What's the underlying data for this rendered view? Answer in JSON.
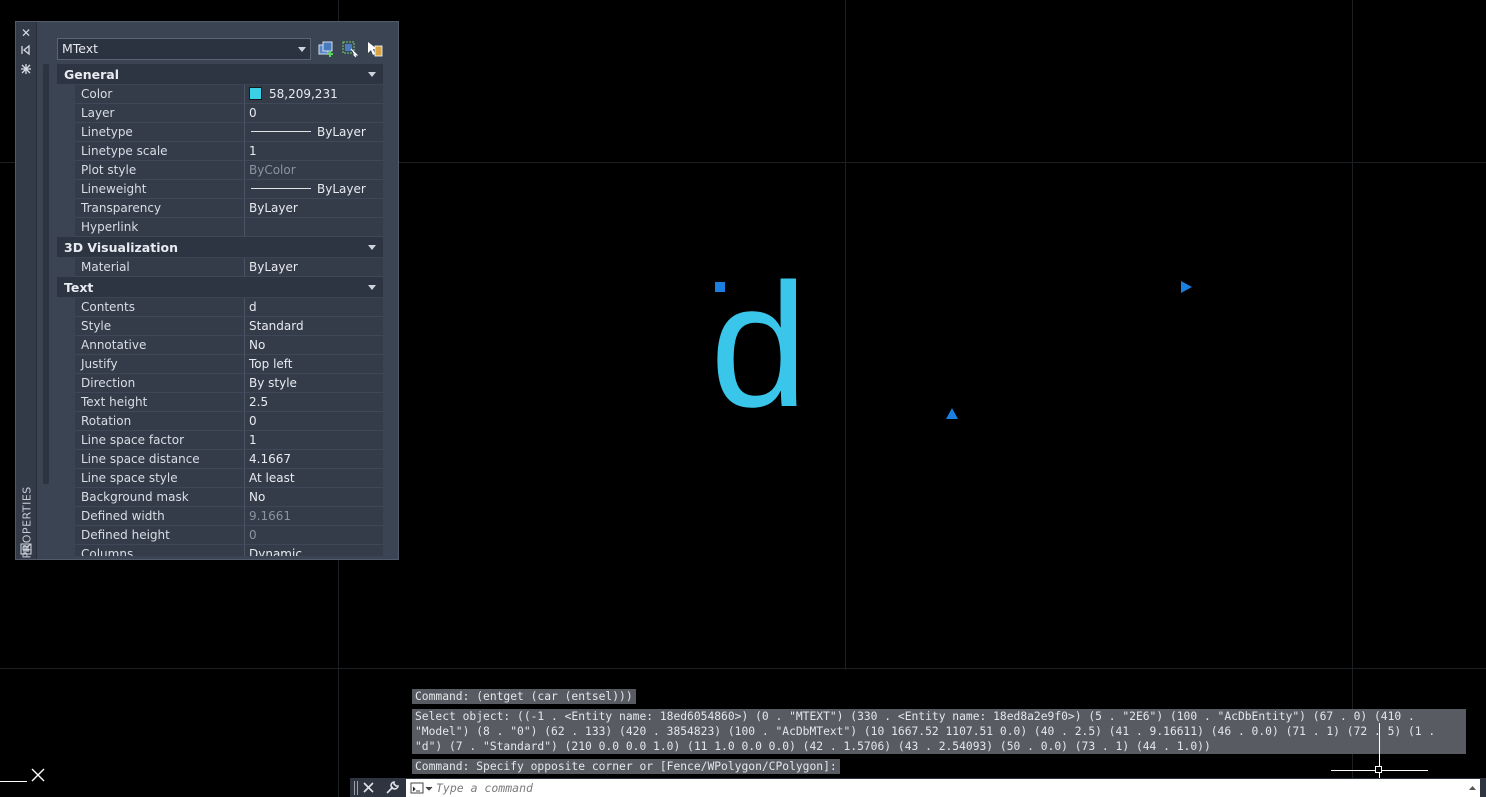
{
  "palette": {
    "title": "PROPERTIES",
    "object_type": "MText",
    "categories": [
      {
        "name": "General",
        "rows": [
          {
            "label": "Color",
            "value": "58,209,231",
            "swatch": "#3ad1e7"
          },
          {
            "label": "Layer",
            "value": "0"
          },
          {
            "label": "Linetype",
            "value": "ByLayer",
            "line": true
          },
          {
            "label": "Linetype scale",
            "value": "1"
          },
          {
            "label": "Plot style",
            "value": "ByColor",
            "dim": true
          },
          {
            "label": "Lineweight",
            "value": "ByLayer",
            "line": true
          },
          {
            "label": "Transparency",
            "value": "ByLayer"
          },
          {
            "label": "Hyperlink",
            "value": ""
          }
        ]
      },
      {
        "name": "3D Visualization",
        "rows": [
          {
            "label": "Material",
            "value": "ByLayer"
          }
        ]
      },
      {
        "name": "Text",
        "rows": [
          {
            "label": "Contents",
            "value": "d"
          },
          {
            "label": "Style",
            "value": "Standard"
          },
          {
            "label": "Annotative",
            "value": "No"
          },
          {
            "label": "Justify",
            "value": "Top left"
          },
          {
            "label": "Direction",
            "value": "By style"
          },
          {
            "label": "Text height",
            "value": "2.5"
          },
          {
            "label": "Rotation",
            "value": "0"
          },
          {
            "label": "Line space factor",
            "value": "1"
          },
          {
            "label": "Line space distance",
            "value": "4.1667"
          },
          {
            "label": "Line space style",
            "value": "At least"
          },
          {
            "label": "Background mask",
            "value": "No"
          },
          {
            "label": "Defined width",
            "value": "9.1661",
            "dim": true
          },
          {
            "label": "Defined height",
            "value": "0",
            "dim": true
          },
          {
            "label": "Columns",
            "value": "Dynamic"
          }
        ]
      }
    ]
  },
  "drawing": {
    "mtext": "d",
    "text_color": "#3ac6eb",
    "grip_color": "#1a7fe0"
  },
  "command_history": [
    "Command: (entget (car (entsel)))",
    "Select object: ((-1 . <Entity name: 18ed6054860>) (0 . \"MTEXT\") (330 . <Entity name: 18ed8a2e9f0>) (5 . \"2E6\") (100 . \"AcDbEntity\") (67 . 0) (410 .\n\"Model\") (8 . \"0\") (62 . 133) (420 . 3854823) (100 . \"AcDbMText\") (10 1667.52 1107.51 0.0) (40 . 2.5) (41 . 9.16611) (46 . 0.0) (71 . 1) (72 . 5) (1 .\n\"d\") (7 . \"Standard\") (210 0.0 0.0 1.0) (11 1.0 0.0 0.0) (42 . 1.5706) (43 . 2.54093) (50 . 0.0) (73 . 1) (44 . 1.0))",
    "Command: Specify opposite corner or [Fence/WPolygon/CPolygon]:"
  ],
  "command_line": {
    "placeholder": "Type a command"
  }
}
